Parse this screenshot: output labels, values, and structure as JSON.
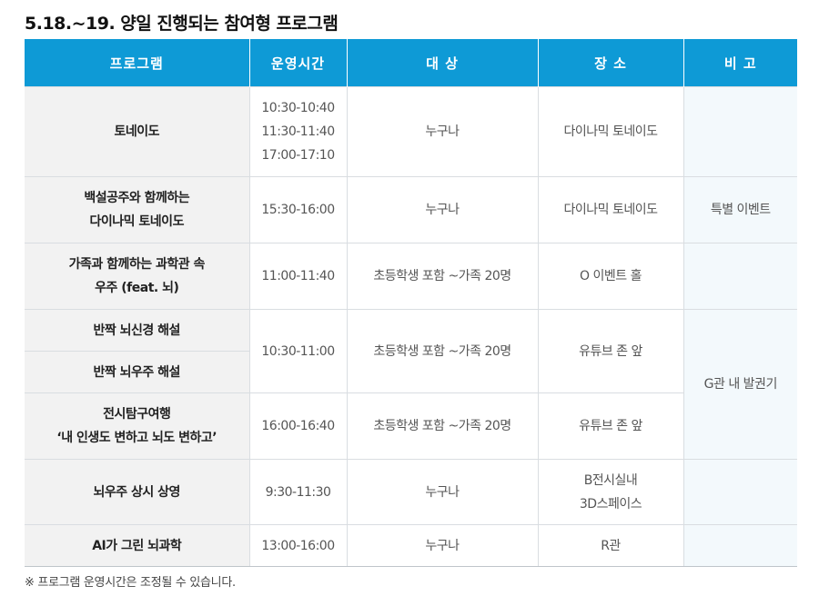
{
  "title": "5.18.~19. 양일 진행되는 참여형 프로그램",
  "headers": [
    "프로그램",
    "운영시간",
    "대 상",
    "장 소",
    "비 고"
  ],
  "rows": [
    {
      "name": [
        "토네이도"
      ],
      "time": [
        "10:30-10:40",
        "11:30-11:40",
        "17:00-17:10"
      ],
      "target": "누구나",
      "place": [
        "다이나믹 토네이도"
      ]
    },
    {
      "name": [
        "백설공주와 함께하는",
        "다이나믹 토네이도"
      ],
      "time": [
        "15:30-16:00"
      ],
      "target": "누구나",
      "place": [
        "다이나믹 토네이도"
      ]
    },
    {
      "name": [
        "가족과 함께하는 과학관 속",
        "우주 (feat. 뇌)"
      ],
      "time": [
        "11:00-11:40"
      ],
      "target": "초등학생 포함 ~가족 20명",
      "place": [
        "O 이벤트 홀"
      ]
    },
    {
      "name": [
        "반짝 뇌신경 해설"
      ],
      "time": [
        "10:30-11:00"
      ],
      "target": "초등학생 포함 ~가족 20명",
      "place": [
        "유튜브 존 앞"
      ]
    },
    {
      "name": [
        "반짝 뇌우주 해설"
      ]
    },
    {
      "name": [
        "전시탐구여행",
        "‘내 인생도 변하고 뇌도 변하고’"
      ],
      "time": [
        "16:00-16:40"
      ],
      "target": "초등학생 포함 ~가족 20명",
      "place": [
        "유튜브 존 앞"
      ]
    },
    {
      "name": [
        "뇌우주 상시 상영"
      ],
      "time": [
        "9:30-11:30"
      ],
      "target": "누구나",
      "place": [
        "B전시실내",
        "3D스페이스"
      ]
    },
    {
      "name": [
        "AI가 그린 뇌과학"
      ],
      "time": [
        "13:00-16:00"
      ],
      "target": "누구나",
      "place": [
        "R관"
      ]
    }
  ],
  "notes": {
    "special_event": "특별 이벤트",
    "g_hall": "G관 내 발권기"
  },
  "footnote": "※ 프로그램 운영시간은 조정될 수 있습니다."
}
